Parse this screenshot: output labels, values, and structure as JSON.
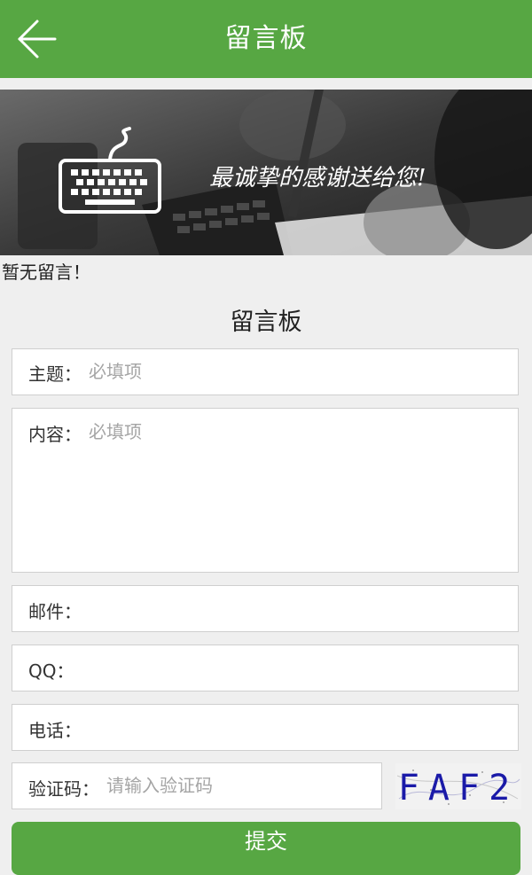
{
  "header": {
    "title": "留言板",
    "back_icon": "arrow-left-icon"
  },
  "banner": {
    "slogan": "最诚挚的感谢送给您!",
    "icon": "keyboard-icon"
  },
  "messages": {
    "empty_text": "暂无留言！"
  },
  "form": {
    "title": "留言板",
    "subject": {
      "label": "主题：",
      "placeholder": "必填项"
    },
    "content": {
      "label": "内容：",
      "placeholder": "必填项"
    },
    "email": {
      "label": "邮件：",
      "placeholder": ""
    },
    "qq": {
      "label": "QQ：",
      "placeholder": ""
    },
    "phone": {
      "label": "电话：",
      "placeholder": ""
    },
    "captcha": {
      "label": "验证码：",
      "placeholder": "请输入验证码",
      "code": "FAF2"
    },
    "submit_label": "提交"
  },
  "colors": {
    "accent": "#57a743",
    "background": "#efefef",
    "captcha_text": "#1a1aa8"
  }
}
